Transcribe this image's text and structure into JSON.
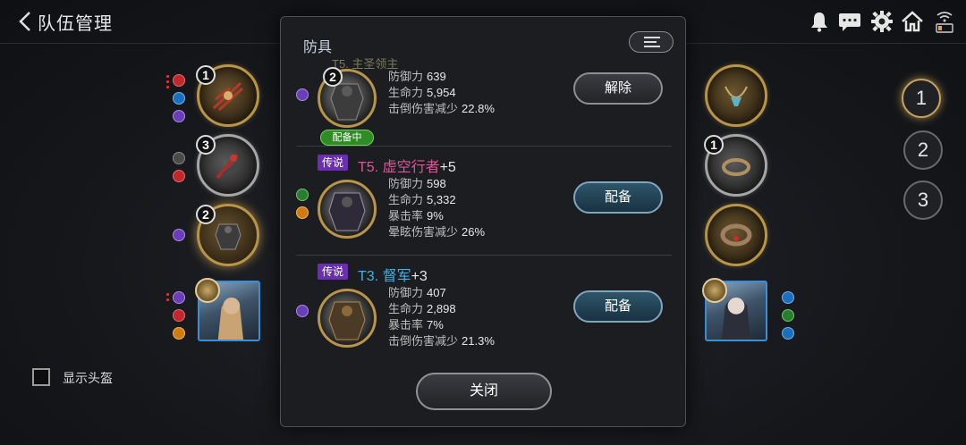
{
  "header": {
    "title": "队伍管理",
    "icons": [
      "back-icon",
      "bell-icon",
      "chat-icon",
      "gear-icon",
      "home-icon",
      "wifi-battery-icon"
    ]
  },
  "left_column": {
    "equipment": [
      {
        "level": "1",
        "icon": "weapon-icon"
      },
      {
        "level": "3",
        "icon": "weapon-icon"
      },
      {
        "level": "2",
        "icon": "armor-icon"
      }
    ]
  },
  "right_column": {
    "equipment": [
      {
        "level": "",
        "icon": "necklace-icon"
      },
      {
        "level": "1",
        "icon": "ring-icon"
      },
      {
        "level": "",
        "icon": "bracelet-icon"
      }
    ]
  },
  "slots": [
    "1",
    "2",
    "3"
  ],
  "show_helmet": {
    "label": "显示头盔",
    "checked": false
  },
  "modal": {
    "title": "防具",
    "top_cut_text": "T5. 主圣领主",
    "items": [
      {
        "level": "2",
        "equipped_label": "配备中",
        "rarity": "",
        "name": "",
        "plus": "",
        "stats": [
          {
            "label": "防御力",
            "value": "639"
          },
          {
            "label": "生命力",
            "value": "5,954"
          },
          {
            "label": "击倒伤害减少",
            "value": "22.8%"
          }
        ],
        "action": "解除"
      },
      {
        "level": "",
        "equipped_label": "",
        "rarity": "传说",
        "name": "T5. 虚空行者",
        "name_color": "#e0559a",
        "plus": "+5",
        "stats": [
          {
            "label": "防御力",
            "value": "598"
          },
          {
            "label": "生命力",
            "value": "5,332"
          },
          {
            "label": "暴击率",
            "value": "9%"
          },
          {
            "label": "晕眩伤害减少",
            "value": "26%"
          }
        ],
        "action": "配备"
      },
      {
        "level": "",
        "equipped_label": "",
        "rarity": "传说",
        "name": "T3. 督军",
        "name_color": "#3fb3e6",
        "plus": "+3",
        "stats": [
          {
            "label": "防御力",
            "value": "407"
          },
          {
            "label": "生命力",
            "value": "2,898"
          },
          {
            "label": "暴击率",
            "value": "7%"
          },
          {
            "label": "击倒伤害减少",
            "value": "21.3%"
          }
        ],
        "action": "配备"
      }
    ],
    "close_label": "关闭"
  }
}
